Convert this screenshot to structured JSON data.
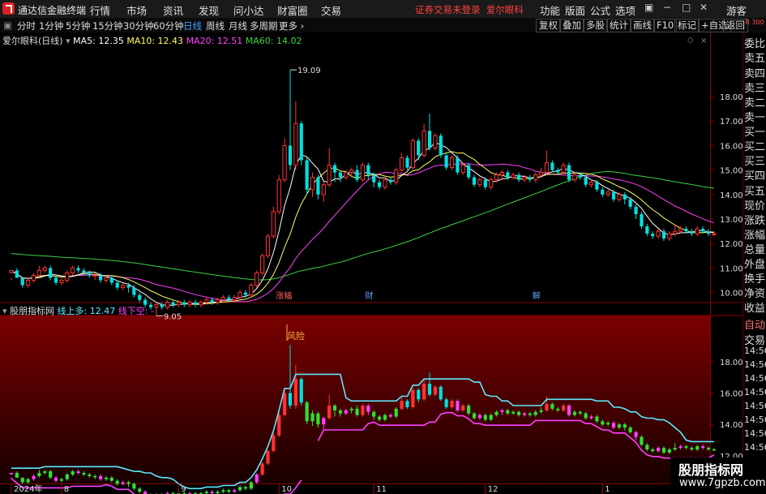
{
  "titlebar": {
    "app_title": "通达信金融终端",
    "menu": [
      "行情",
      "市场",
      "资讯",
      "发现",
      "问小达",
      "财富圈",
      "交易"
    ],
    "notice_login": "证券交易未登录",
    "notice_stock": "爱尔眼科",
    "right_menu": [
      "功能",
      "版面",
      "公式",
      "选项"
    ],
    "guest": "游客"
  },
  "toolbar": {
    "periods": [
      "分时",
      "1分钟",
      "5分钟",
      "15分钟",
      "30分钟",
      "60分钟",
      "日线",
      "周线",
      "月线",
      "多周期",
      "更多"
    ],
    "active_period": "日线",
    "right_buttons": [
      "复权",
      "叠加",
      "多股",
      "统计",
      "画线",
      "F10",
      "标记",
      "+自选",
      "返回"
    ]
  },
  "main_legend": {
    "name": "爱尔眼科(日线)",
    "ma5": "MA5: 12.35",
    "ma10": "MA10: 12.43",
    "ma20": "MA20: 12.51",
    "ma60": "MA60: 14.02"
  },
  "indicator_legend": {
    "name": "股朋指标网",
    "up": "线上多: 12.47",
    "down": "线下空: -"
  },
  "right_panel": {
    "top": "R 300",
    "items": [
      "委比",
      "卖五",
      "卖四",
      "卖三",
      "卖二",
      "卖一",
      "买一",
      "买二",
      "买三",
      "买四",
      "买五",
      "现价",
      "涨跌",
      "涨幅",
      "总量",
      "外盘",
      "换手",
      "净资",
      "收益",
      "自动",
      "交易",
      "14:56",
      "14:56",
      "14:56",
      "14:56",
      "14:56",
      "14:56",
      "14:56",
      "14:56",
      "14:56"
    ]
  },
  "watermark": {
    "line1": "股朋指标网",
    "line2": "www.7gpzb.com"
  },
  "colors": {
    "up": "#ff3232",
    "down": "#00e0e0",
    "ma5": "#ffffff",
    "ma10": "#ffff60",
    "ma20": "#ff40ff",
    "ma60": "#40d040",
    "ind_up": "#60e8ff",
    "ind_down": "#ff40ff",
    "ind_green": "#30e030"
  },
  "chart_data": {
    "type": "candlestick",
    "main": {
      "yticks": [
        10.0,
        11.0,
        12.0,
        13.0,
        14.0,
        15.0,
        16.0,
        17.0,
        18.0
      ],
      "annotations": [
        {
          "text": "19.09",
          "type": "high"
        },
        {
          "text": "9.05",
          "type": "low"
        }
      ],
      "events": [
        "涨幅",
        "财",
        "解"
      ]
    },
    "indicator": {
      "yticks": [
        12.0,
        14.0,
        16.0,
        18.0
      ],
      "annotations": [
        "风险"
      ]
    },
    "xticks": [
      "2024年",
      "8",
      "9",
      "10",
      "11",
      "12",
      "1"
    ],
    "candles": [
      [
        10.8,
        10.9,
        10.6,
        10.5
      ],
      [
        10.9,
        10.6,
        10.6,
        11.0
      ],
      [
        10.6,
        10.3,
        10.4,
        10.2
      ],
      [
        10.3,
        10.5,
        10.6,
        10.2
      ],
      [
        10.5,
        10.7,
        10.8,
        10.4
      ],
      [
        10.7,
        10.9,
        11.1,
        10.6
      ],
      [
        10.9,
        11.0,
        11.1,
        10.8
      ],
      [
        11.0,
        10.6,
        11.1,
        10.5
      ],
      [
        10.6,
        10.4,
        10.7,
        10.3
      ],
      [
        10.4,
        10.5,
        10.6,
        10.3
      ],
      [
        10.5,
        10.8,
        10.9,
        10.4
      ],
      [
        10.8,
        11.0,
        11.1,
        10.7
      ],
      [
        11.0,
        10.9,
        11.1,
        10.8
      ],
      [
        10.9,
        10.8,
        11.0,
        10.7
      ],
      [
        10.8,
        10.7,
        10.9,
        10.6
      ],
      [
        10.7,
        10.7,
        10.8,
        10.5
      ],
      [
        10.7,
        10.5,
        10.8,
        10.4
      ],
      [
        10.5,
        10.6,
        10.7,
        10.4
      ],
      [
        10.6,
        10.4,
        10.7,
        10.3
      ],
      [
        10.4,
        10.2,
        10.5,
        10.1
      ],
      [
        10.2,
        10.3,
        10.4,
        10.1
      ],
      [
        10.3,
        10.2,
        10.4,
        10.0
      ],
      [
        10.2,
        9.9,
        10.3,
        9.8
      ],
      [
        9.9,
        9.7,
        10.0,
        9.6
      ],
      [
        9.7,
        9.5,
        9.8,
        9.4
      ],
      [
        9.5,
        9.4,
        9.6,
        9.3
      ],
      [
        9.4,
        9.5,
        9.6,
        9.05
      ],
      [
        9.5,
        9.4,
        9.6,
        9.3
      ],
      [
        9.4,
        9.6,
        9.7,
        9.3
      ],
      [
        9.6,
        9.5,
        9.7,
        9.4
      ],
      [
        9.5,
        9.6,
        9.7,
        9.4
      ],
      [
        9.6,
        9.5,
        9.7,
        9.4
      ],
      [
        9.5,
        9.6,
        9.7,
        9.4
      ],
      [
        9.6,
        9.5,
        9.7,
        9.4
      ],
      [
        9.5,
        9.6,
        9.7,
        9.4
      ],
      [
        9.6,
        9.7,
        9.8,
        9.5
      ],
      [
        9.7,
        9.6,
        9.8,
        9.5
      ],
      [
        9.6,
        9.7,
        9.8,
        9.5
      ],
      [
        9.7,
        9.8,
        9.9,
        9.6
      ],
      [
        9.8,
        9.7,
        9.9,
        9.6
      ],
      [
        9.7,
        9.8,
        9.9,
        9.6
      ],
      [
        9.8,
        10.0,
        10.1,
        9.7
      ],
      [
        10.0,
        9.9,
        10.1,
        9.8
      ],
      [
        9.9,
        10.3,
        10.4,
        9.8
      ],
      [
        10.3,
        10.8,
        10.9,
        10.2
      ],
      [
        10.8,
        11.5,
        11.6,
        10.7
      ],
      [
        11.5,
        12.3,
        12.4,
        11.4
      ],
      [
        12.3,
        13.3,
        13.5,
        12.2
      ],
      [
        13.3,
        14.6,
        14.8,
        13.2
      ],
      [
        14.6,
        16.0,
        16.3,
        14.5
      ],
      [
        16.0,
        15.2,
        19.09,
        15.0
      ],
      [
        15.2,
        16.9,
        17.8,
        15.0
      ],
      [
        16.9,
        15.4,
        17.0,
        15.2
      ],
      [
        15.4,
        14.2,
        15.5,
        14.0
      ],
      [
        14.2,
        14.7,
        14.9,
        13.9
      ],
      [
        14.7,
        14.0,
        14.8,
        13.8
      ],
      [
        14.0,
        14.4,
        14.5,
        13.7
      ],
      [
        14.4,
        15.2,
        15.9,
        14.3
      ],
      [
        15.2,
        14.9,
        15.3,
        14.5
      ],
      [
        14.9,
        14.7,
        15.0,
        14.5
      ],
      [
        14.7,
        14.9,
        15.0,
        14.6
      ],
      [
        14.9,
        15.0,
        15.1,
        14.7
      ],
      [
        15.0,
        14.6,
        15.2,
        14.5
      ],
      [
        14.6,
        15.2,
        15.3,
        14.5
      ],
      [
        15.2,
        14.8,
        15.3,
        14.6
      ],
      [
        14.8,
        14.5,
        14.9,
        14.3
      ],
      [
        14.5,
        14.3,
        14.6,
        14.2
      ],
      [
        14.3,
        14.6,
        14.7,
        14.2
      ],
      [
        14.6,
        14.5,
        14.7,
        14.4
      ],
      [
        14.5,
        15.0,
        15.1,
        14.4
      ],
      [
        15.0,
        15.5,
        15.7,
        14.9
      ],
      [
        15.5,
        15.1,
        15.6,
        15.0
      ],
      [
        15.1,
        16.2,
        16.3,
        15.0
      ],
      [
        16.2,
        15.6,
        16.3,
        15.4
      ],
      [
        15.6,
        16.6,
        16.9,
        15.5
      ],
      [
        16.6,
        15.9,
        17.3,
        15.8
      ],
      [
        15.9,
        16.4,
        16.5,
        15.8
      ],
      [
        16.4,
        15.6,
        16.5,
        15.5
      ],
      [
        15.6,
        15.1,
        15.7,
        15.0
      ],
      [
        15.1,
        15.5,
        15.6,
        15.0
      ],
      [
        15.5,
        14.9,
        15.6,
        14.8
      ],
      [
        14.9,
        15.2,
        15.3,
        14.8
      ],
      [
        15.2,
        14.7,
        15.3,
        14.6
      ],
      [
        14.7,
        14.4,
        14.8,
        14.3
      ],
      [
        14.4,
        14.6,
        14.7,
        14.3
      ],
      [
        14.6,
        14.3,
        14.7,
        14.2
      ],
      [
        14.3,
        14.6,
        14.7,
        14.2
      ],
      [
        14.6,
        14.8,
        14.9,
        14.5
      ],
      [
        14.8,
        14.9,
        15.0,
        14.6
      ],
      [
        14.9,
        14.7,
        15.0,
        14.6
      ],
      [
        14.7,
        14.8,
        14.9,
        14.6
      ],
      [
        14.8,
        14.6,
        14.9,
        14.5
      ],
      [
        14.6,
        14.7,
        14.8,
        14.5
      ],
      [
        14.7,
        14.6,
        14.8,
        14.5
      ],
      [
        14.6,
        14.8,
        14.9,
        14.5
      ],
      [
        14.8,
        14.9,
        15.1,
        14.7
      ],
      [
        14.9,
        15.3,
        15.8,
        14.8
      ],
      [
        15.3,
        15.0,
        15.4,
        14.9
      ],
      [
        15.0,
        14.9,
        15.1,
        14.8
      ],
      [
        14.9,
        15.2,
        15.3,
        14.8
      ],
      [
        15.2,
        14.6,
        15.3,
        14.5
      ],
      [
        14.6,
        14.8,
        14.9,
        14.5
      ],
      [
        14.8,
        14.7,
        14.9,
        14.6
      ],
      [
        14.7,
        14.4,
        14.8,
        14.3
      ],
      [
        14.4,
        14.5,
        14.6,
        14.3
      ],
      [
        14.5,
        14.2,
        14.6,
        14.1
      ],
      [
        14.2,
        14.0,
        14.3,
        13.9
      ],
      [
        14.0,
        14.1,
        14.2,
        13.9
      ],
      [
        14.1,
        13.8,
        14.2,
        13.7
      ],
      [
        13.8,
        14.0,
        14.1,
        13.7
      ],
      [
        14.0,
        13.8,
        14.1,
        13.6
      ],
      [
        13.8,
        13.5,
        13.9,
        13.4
      ],
      [
        13.5,
        13.2,
        13.6,
        13.0
      ],
      [
        13.2,
        12.7,
        13.3,
        12.6
      ],
      [
        12.7,
        12.4,
        12.8,
        12.3
      ],
      [
        12.4,
        12.3,
        12.5,
        12.2
      ],
      [
        12.3,
        12.5,
        12.6,
        12.2
      ],
      [
        12.5,
        12.2,
        12.6,
        12.1
      ],
      [
        12.2,
        12.4,
        12.5,
        12.1
      ],
      [
        12.4,
        12.5,
        12.8,
        12.3
      ],
      [
        12.5,
        12.6,
        12.7,
        12.4
      ],
      [
        12.6,
        12.5,
        12.7,
        12.4
      ],
      [
        12.5,
        12.4,
        12.6,
        12.3
      ],
      [
        12.4,
        12.6,
        12.7,
        12.3
      ],
      [
        12.6,
        12.5,
        12.7,
        12.4
      ],
      [
        12.5,
        12.4,
        12.6,
        12.3
      ],
      [
        12.4,
        12.4,
        12.5,
        12.3
      ]
    ]
  }
}
